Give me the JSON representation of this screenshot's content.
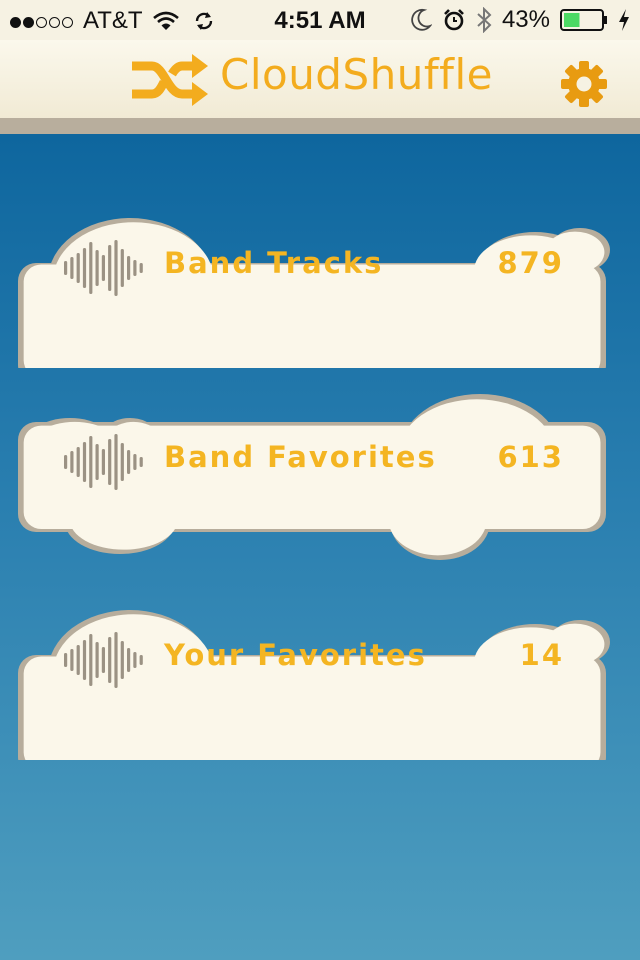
{
  "status_bar": {
    "signal_bars": 2,
    "carrier": "AT&T",
    "time": "4:51 AM",
    "battery_percent": "43%",
    "icons": [
      "wifi-icon",
      "sync-icon",
      "moon-icon",
      "alarm-icon",
      "bluetooth-icon",
      "battery-icon",
      "charging-icon"
    ],
    "battery_level": 0.43
  },
  "header": {
    "title": "CloudShuffle",
    "logo_icon": "shuffle-icon",
    "settings_icon": "gear-icon"
  },
  "colors": {
    "accent": "#f4b522",
    "header_bg": "#f6f2e3",
    "content_top": "#0e669e",
    "content_bottom": "#4f9ebf",
    "cloud_fill": "#fbf7ea",
    "cloud_border": "#b7ad9c"
  },
  "lists": [
    {
      "label": "Band Tracks",
      "count": "879",
      "icon": "soundwave-icon"
    },
    {
      "label": "Band Favorites",
      "count": "613",
      "icon": "soundwave-icon"
    },
    {
      "label": "Your Favorites",
      "count": "14",
      "icon": "soundwave-icon"
    }
  ]
}
